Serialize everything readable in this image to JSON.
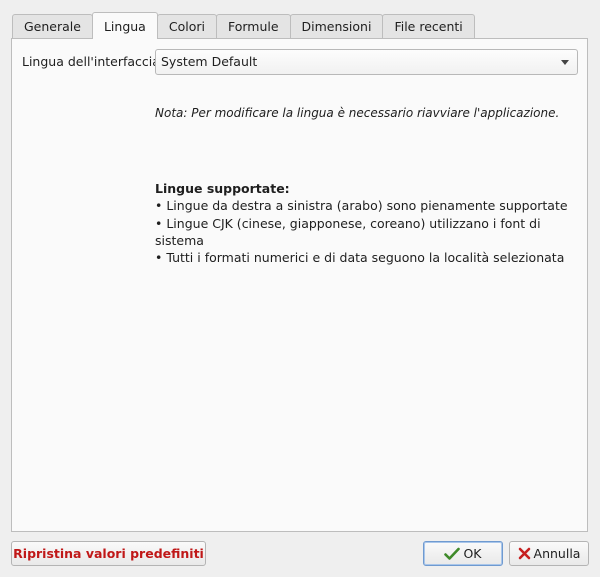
{
  "tabs": [
    {
      "label": "Generale",
      "active": false
    },
    {
      "label": "Lingua",
      "active": true
    },
    {
      "label": "Colori",
      "active": false
    },
    {
      "label": "Formule",
      "active": false
    },
    {
      "label": "Dimensioni",
      "active": false
    },
    {
      "label": "File recenti",
      "active": false
    }
  ],
  "language": {
    "label": "Lingua dell'interfaccia:",
    "selected": "System Default",
    "note": "Nota: Per modificare la lingua è necessario riavviare l'applicazione.",
    "supported_title": "Lingue supportate:",
    "supported_items": [
      "• Lingue da destra a sinistra (arabo) sono pienamente supportate",
      "• Lingue CJK (cinese, giapponese, coreano) utilizzano i font di sistema",
      "• Tutti i formati numerici e di data seguono la località selezionata"
    ]
  },
  "buttons": {
    "reset": "Ripristina valori predefiniti",
    "ok": "OK",
    "cancel": "Annulla"
  },
  "colors": {
    "reset_text": "#c01818",
    "ok_icon": "#3f8a2a",
    "cancel_icon": "#c62020"
  },
  "icons": {
    "ok": "checkmark-icon",
    "cancel": "x-icon"
  }
}
